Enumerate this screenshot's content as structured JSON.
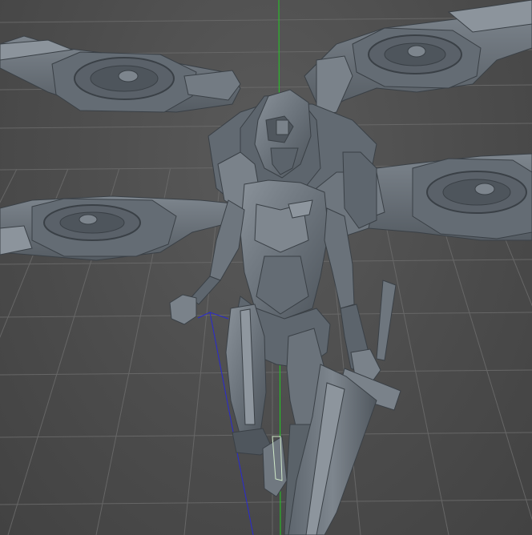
{
  "viewport": {
    "background": "#4c4c4c",
    "grid_line_color": "#6a6a6a",
    "axis_y_color": "#22cc22",
    "axis_z_color": "#2a2ad0",
    "model_base_color": "#6a737c",
    "model_light_color": "#8d959d",
    "model_dark_color": "#4a5158",
    "model_edge_color": "#3a4046"
  },
  "scene": {
    "object_name": "mech-winged-character",
    "drone_icons": [
      "drone-rotor-top-left",
      "drone-rotor-top-right",
      "drone-rotor-mid-left",
      "drone-rotor-mid-right"
    ]
  }
}
